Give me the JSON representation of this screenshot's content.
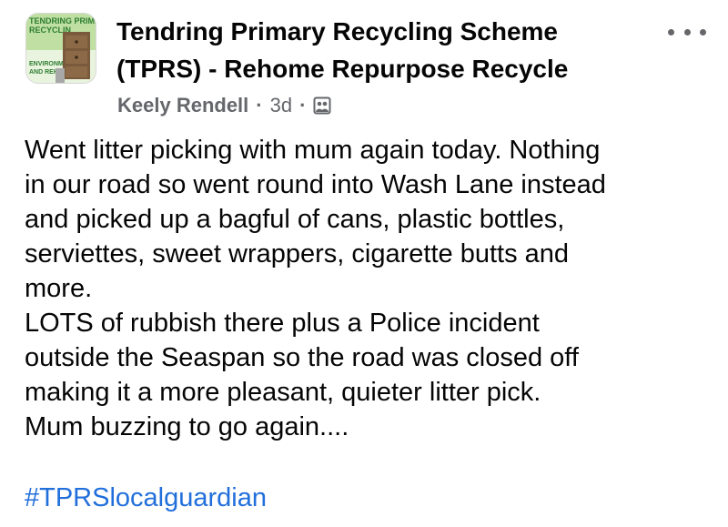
{
  "group": {
    "name_line1": "Tendring Primary Recycling Scheme",
    "name_line2": "(TPRS) - Rehome Repurpose Recycle",
    "avatar_text": {
      "top_line1": "TENDRING PRIMARY",
      "top_line2": "RECYCLIN",
      "bottom_line1": "ENVIRONM",
      "bottom_line2": "AND REHOM"
    }
  },
  "post_meta": {
    "author": "Keely Rendell",
    "separator": "·",
    "age": "3d",
    "privacy_icon": "group-members-icon"
  },
  "post": {
    "lines": [
      "Went litter picking with mum again today. Nothing",
      "in our road so went round into Wash Lane instead",
      "and picked up a bagful of cans, plastic bottles,",
      "serviettes, sweet wrappers, cigarette butts and",
      "more.",
      "LOTS of rubbish there plus a Police incident",
      "outside the Seaspan so the road was closed off",
      "making it a more pleasant, quieter litter pick.",
      "Mum buzzing to go again...."
    ],
    "hashtag": "#TPRSlocalguardian"
  },
  "colors": {
    "text_primary": "#050505",
    "text_secondary": "#65676b",
    "link": "#216fdb",
    "background": "#ffffff"
  },
  "icons": {
    "more": "more-options-icon"
  }
}
